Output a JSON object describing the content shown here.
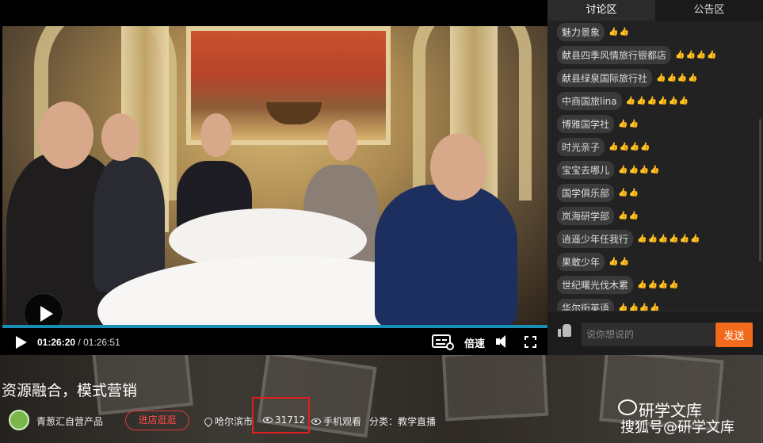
{
  "player": {
    "current_time": "01:26:20",
    "separator": " / ",
    "total_time": "01:26:51",
    "speed_label": "倍速"
  },
  "panel": {
    "tabs": [
      {
        "label": "讨论区",
        "active": true
      },
      {
        "label": "公告区",
        "active": false
      }
    ],
    "messages": [
      {
        "name": "魅力景象",
        "likes": "👍👍"
      },
      {
        "name": "献县四季风情旅行银都店",
        "likes": "👍👍👍👍"
      },
      {
        "name": "献县绿泉国际旅行社",
        "likes": "👍👍👍👍"
      },
      {
        "name": "中商国旅lina",
        "likes": "👍👍👍👍👍👍"
      },
      {
        "name": "博雅国学社",
        "likes": "👍👍"
      },
      {
        "name": "时光亲子",
        "likes": "👍👍👍👍"
      },
      {
        "name": "宝宝去哪儿",
        "likes": "👍👍👍👍"
      },
      {
        "name": "国学俱乐部",
        "likes": "👍👍"
      },
      {
        "name": "岚海研学部",
        "likes": "👍👍"
      },
      {
        "name": "逍遥少年任我行",
        "likes": "👍👍👍👍👍👍"
      },
      {
        "name": "果敢少年",
        "likes": "👍👍"
      },
      {
        "name": "世纪曙光伐木累",
        "likes": "👍👍👍👍"
      },
      {
        "name": "华尔街英语",
        "likes": "👍👍👍👍"
      }
    ],
    "input_placeholder": "说你想说的",
    "send_label": "发送"
  },
  "info": {
    "title": "资源融合，模式营销",
    "shop_name": "青葱汇自营产品",
    "shop_button": "进店逛逛",
    "location": "哈尔滨市",
    "views": "31712",
    "watch_mobile": "手机观看",
    "category": "分类：教学直播"
  },
  "watermark": {
    "line1": "研学文库",
    "line2": "搜狐号@研学文库"
  },
  "colors": {
    "accent": "#f26b1d",
    "progress": "#1a8fb5",
    "highlight": "#e02020",
    "shop_button": "#ff4b4b"
  }
}
